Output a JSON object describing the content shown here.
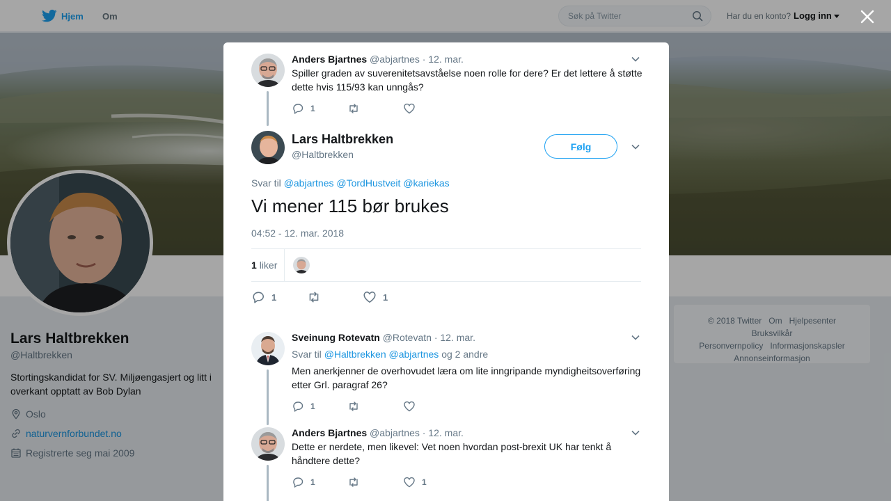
{
  "nav": {
    "home_label": "Hjem",
    "about_label": "Om",
    "search_placeholder": "Søk på Twitter",
    "account_question": "Har du en konto?",
    "login_label": "Logg inn"
  },
  "profile": {
    "name": "Lars Haltbrekken",
    "handle": "@Haltbrekken",
    "bio": "Stortingskandidat for SV. Miljøengasjert og litt i overkant opptatt av Bob Dylan",
    "location": "Oslo",
    "website": "naturvernforbundet.no",
    "joined": "Registrerte seg mai 2009"
  },
  "footer": {
    "items": [
      "© 2018 Twitter",
      "Om",
      "Hjelpesenter",
      "Bruksvilkår",
      "Personvernpolicy",
      "Informasjonskapsler",
      "Annonseinformasjon"
    ]
  },
  "thread": {
    "parent": {
      "name": "Anders Bjartnes",
      "handle": "@abjartnes",
      "date": "· 12. mar.",
      "text": "Spiller graden av suverenitetsavståelse noen rolle for dere? Er det lettere å støtte dette hvis 115/93 kan unngås?",
      "replies": "1",
      "retweets": "",
      "likes": ""
    },
    "main": {
      "name": "Lars Haltbrekken",
      "handle": "@Haltbrekken",
      "follow_label": "Følg",
      "replying_prefix": "Svar til",
      "replying_to": [
        "@abjartnes",
        "@TordHustveit",
        "@kariekas"
      ],
      "text": "Vi mener 115 bør brukes",
      "timestamp": "04:52 - 12. mar. 2018",
      "like_count": "1",
      "like_word": "liker",
      "replies": "1",
      "retweets": "",
      "likes": "1"
    },
    "replies": [
      {
        "name": "Sveinung Rotevatn",
        "handle": "@Rotevatn",
        "date": "· 12. mar.",
        "replying_prefix": "Svar til",
        "replying_to": [
          "@Haltbrekken",
          "@abjartnes"
        ],
        "replying_suffix": "og 2 andre",
        "text": "Men anerkjenner de overhovudet læra om lite inngripande myndigheitsoverføring etter Grl. paragraf 26?",
        "replies": "1",
        "retweets": "",
        "likes": ""
      },
      {
        "name": "Anders Bjartnes",
        "handle": "@abjartnes",
        "date": "· 12. mar.",
        "text": "Dette er nerdete, men likevel: Vet noen hvordan post-brexit UK har tenkt å håndtere dette?",
        "replies": "1",
        "retweets": "",
        "likes": "1"
      }
    ]
  },
  "colors": {
    "accent": "#1da1f2",
    "link": "#1b95e0",
    "text": "#14171a",
    "muted": "#657786",
    "thread_line": "#aab8c2"
  }
}
